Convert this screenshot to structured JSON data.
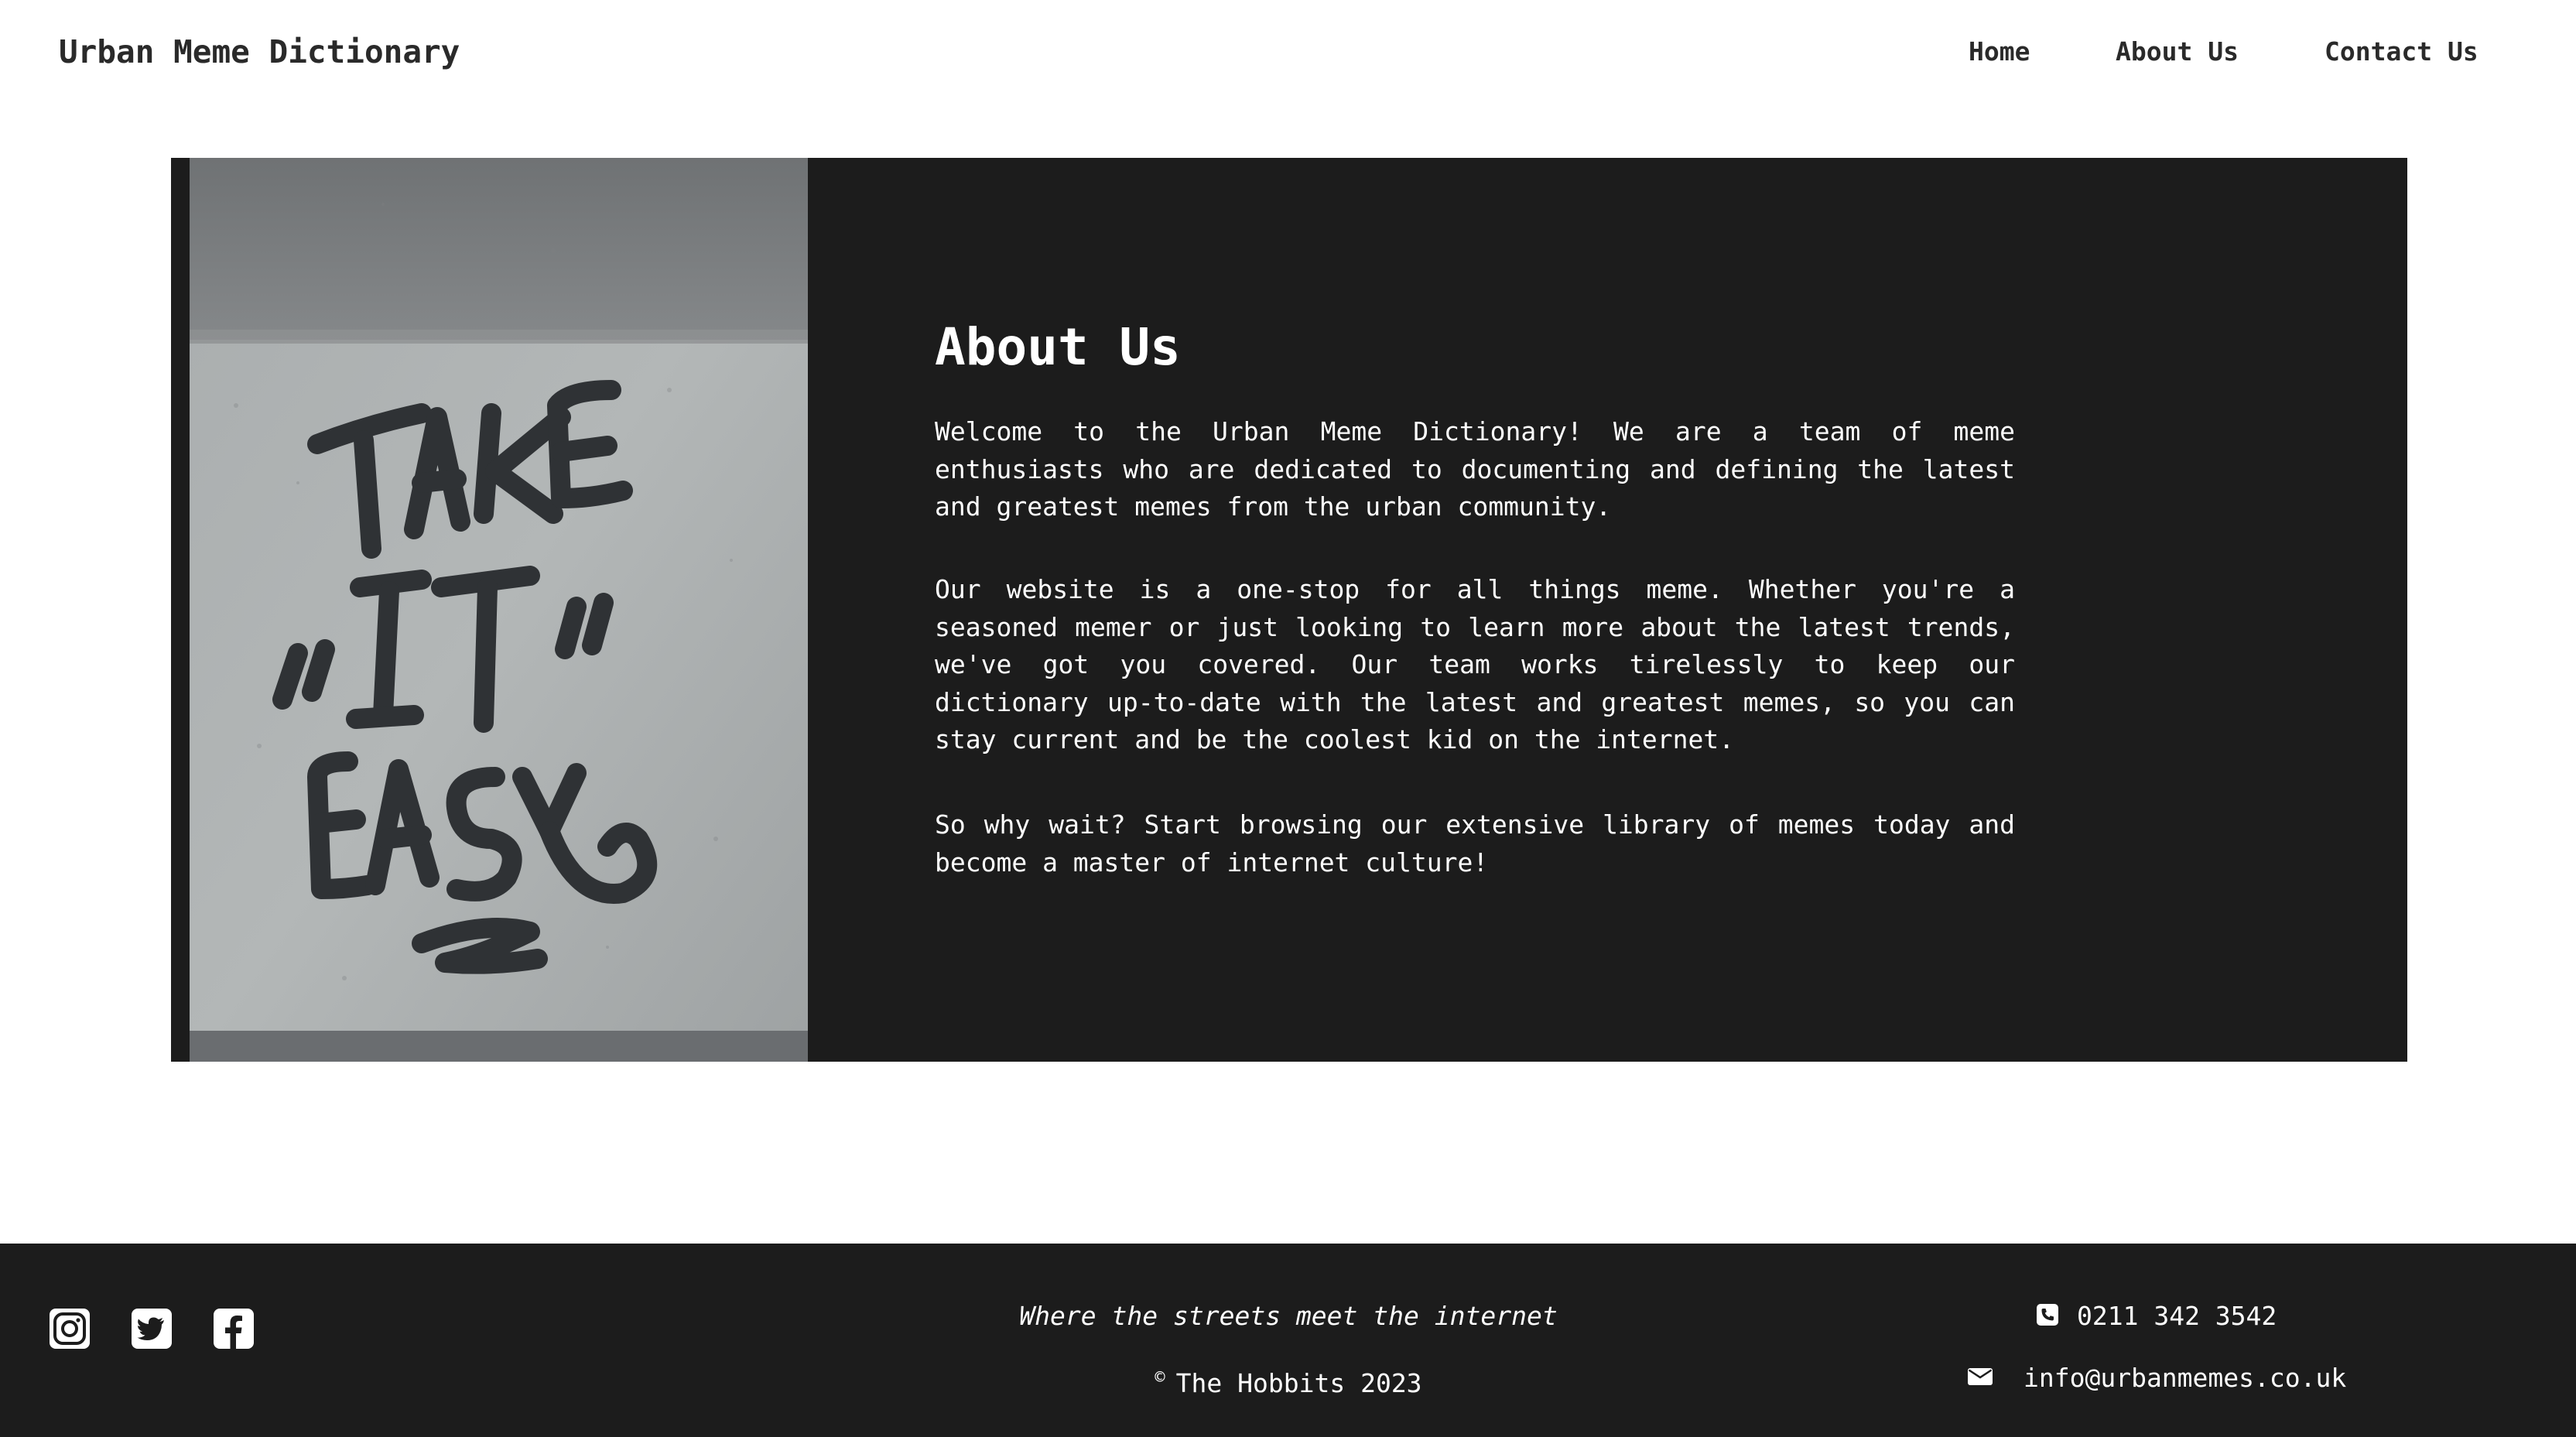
{
  "header": {
    "brand": "Urban Meme Dictionary",
    "nav": [
      {
        "label": "Home"
      },
      {
        "label": "About Us"
      },
      {
        "label": "Contact Us"
      }
    ]
  },
  "about": {
    "image_alt": "TAKE \"IT\" EASY",
    "title": "About Us",
    "paragraphs": [
      "Welcome to the Urban Meme Dictionary! We are a team of meme enthusiasts who are dedicated to documenting and defining the latest and greatest memes from the urban community.",
      "Our website is a one-stop for all things meme. Whether you're a seasoned memer or just looking to learn more about the latest trends, we've got you covered. Our team works tirelessly to keep our dictionary up-to-date with the latest and greatest memes, so you can stay current and be the coolest kid on the internet.",
      "So why wait? Start browsing our extensive library of memes today and become a master of internet culture!"
    ]
  },
  "footer": {
    "social": [
      {
        "icon": "instagram-icon"
      },
      {
        "icon": "twitter-icon"
      },
      {
        "icon": "facebook-icon"
      }
    ],
    "tagline": "Where the streets meet the internet",
    "copyright_symbol": "©",
    "copyright": "The Hobbits 2023",
    "phone": "0211 342 3542",
    "email": "info@urbanmemes.co.uk"
  },
  "colors": {
    "dark": "#1c1c1c",
    "text_dark": "#2a2a2a",
    "text_light": "#ffffff"
  }
}
